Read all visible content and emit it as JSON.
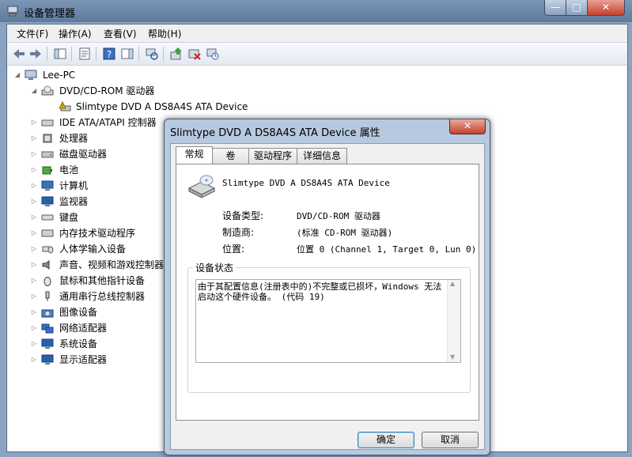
{
  "window": {
    "title": "设备管理器"
  },
  "caption_buttons": {
    "minimize": "—",
    "maximize": "□",
    "close": "✕"
  },
  "menu": [
    "文件(F)",
    "操作(A)",
    "查看(V)",
    "帮助(H)"
  ],
  "toolbar_icons": [
    "back-icon",
    "forward-icon",
    "show-hide-console-tree-icon",
    "properties-icon",
    "help-icon",
    "action-pane-icon",
    "scan-hardware-icon",
    "update-driver-icon",
    "uninstall-icon",
    "disable-icon"
  ],
  "tree": {
    "root": "Lee-PC",
    "dvd_category": "DVD/CD-ROM 驱动器",
    "dvd_device": "Slimtype DVD A  DS8A4S ATA Device",
    "categories": [
      "IDE ATA/ATAPI 控制器",
      "处理器",
      "磁盘驱动器",
      "电池",
      "计算机",
      "监视器",
      "键盘",
      "内存技术驱动程序",
      "人体学输入设备",
      "声音、视频和游戏控制器",
      "鼠标和其他指针设备",
      "通用串行总线控制器",
      "图像设备",
      "网络适配器",
      "系统设备",
      "显示适配器"
    ]
  },
  "dialog": {
    "title": "Slimtype DVD A  DS8A4S ATA Device 属性",
    "close": "✕",
    "tabs": [
      "常规",
      "卷",
      "驱动程序",
      "详细信息"
    ],
    "device_name": "Slimtype DVD A  DS8A4S ATA Device",
    "props": [
      {
        "label": "设备类型:",
        "value": "DVD/CD-ROM 驱动器"
      },
      {
        "label": "制造商:",
        "value": "(标准 CD-ROM 驱动器)"
      },
      {
        "label": "位置:",
        "value": "位置 0 (Channel 1, Target 0, Lun 0)"
      }
    ],
    "status_legend": "设备状态",
    "status_text": "由于其配置信息(注册表中的)不完整或已损坏，Windows 无法启动这个硬件设备。 (代码 19)",
    "ok": "确定",
    "cancel": "取消"
  }
}
